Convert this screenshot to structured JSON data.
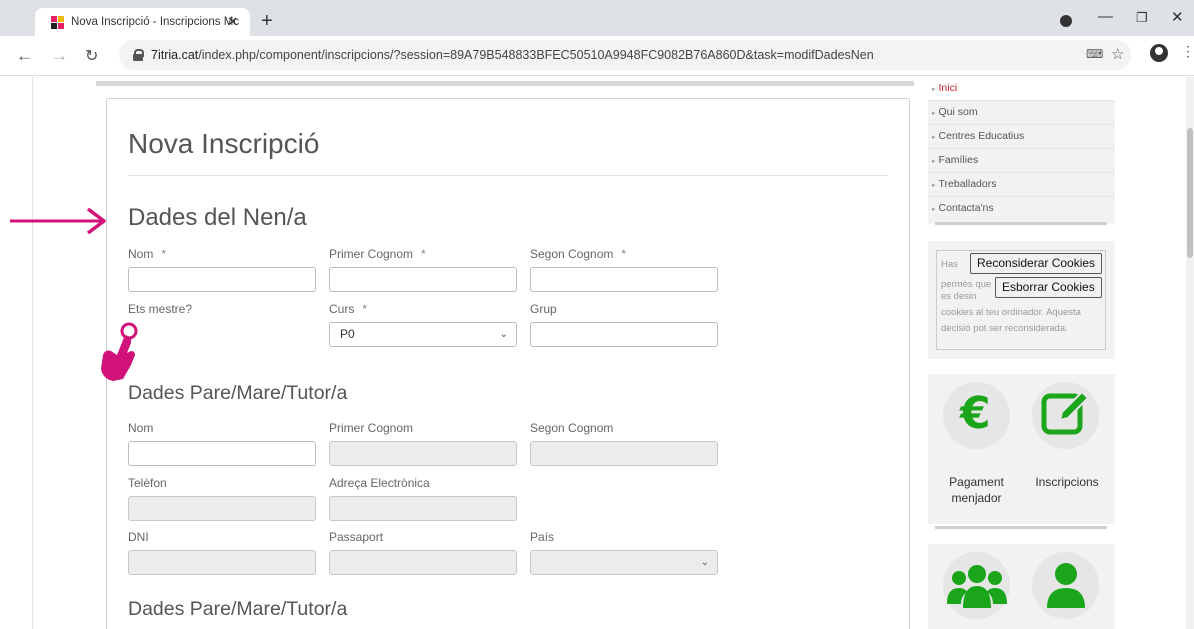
{
  "browser": {
    "tab_title": "Nova Inscripció - Inscripcions Mc",
    "url_host": "7itria.cat",
    "url_path": "/index.php/component/inscripcions/?session=89A79B548833BFEC50510A9948FC9082B76A860D&task=modifDadesNen"
  },
  "form": {
    "title": "Nova Inscripció",
    "child_section": {
      "title": "Dades del Nen/a",
      "nom_label": "Nom",
      "primer_cognom_label": "Primer Cognom",
      "segon_cognom_label": "Segon Cognom",
      "required_mark": "*",
      "mestre_label": "Ets mestre?",
      "curs_label": "Curs",
      "curs_value": "P0",
      "grup_label": "Grup"
    },
    "parent_section_1": {
      "title": "Dades Pare/Mare/Tutor/a",
      "nom_label": "Nom",
      "primer_cognom_label": "Primer Cognom",
      "segon_cognom_label": "Segon Cognom",
      "telefon_label": "Telèfon",
      "email_label": "Adreça Electrònica",
      "dni_label": "DNI",
      "passaport_label": "Passaport",
      "pais_label": "País"
    },
    "parent_section_2": {
      "title": "Dades Pare/Mare/Tutor/a"
    }
  },
  "sidebar": {
    "menu": [
      "Inici",
      "Qui som",
      "Centres Educatius",
      "Famílies",
      "Treballadors",
      "Contacta'ns"
    ],
    "cookie": {
      "line1": "Has",
      "line2": "permès que",
      "line3": "es desin",
      "line4": "cookies al teu ordinador. Aquesta",
      "line5": "decisió pot ser reconsiderada.",
      "reconsider_button": "Reconsiderar Cookies",
      "delete_button": "Esborrar Cookies"
    },
    "widgets": {
      "payment_label_1": "Pagament",
      "payment_label_2": "menjador",
      "inscriptions_label": "Inscripcions"
    }
  },
  "colors": {
    "accent_green": "#1aa51a",
    "annotation_magenta": "#d1127a",
    "menu_active": "#c4202a"
  }
}
